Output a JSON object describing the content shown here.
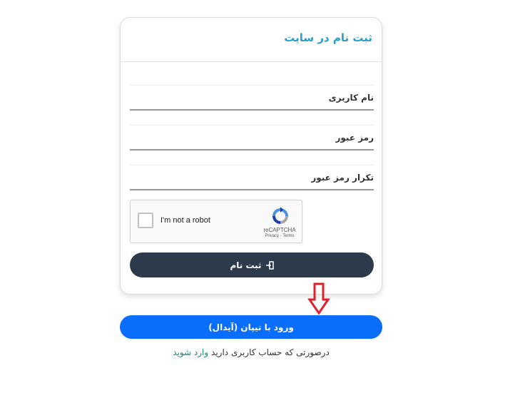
{
  "form": {
    "title": "ثبت نام در سایت",
    "fields": [
      {
        "placeholder": "نام کاربری",
        "value": ""
      },
      {
        "placeholder": "رمز عبور",
        "value": ""
      },
      {
        "placeholder": "تکرار رمز عبور",
        "value": ""
      }
    ],
    "captcha": {
      "label": "I'm not a robot",
      "brand": "reCAPTCHA",
      "links": "Privacy - Terms",
      "checked": false
    },
    "register_label": "ثبت نام",
    "register_icon": "sign-in-icon"
  },
  "login": {
    "label": "ورود با تیپان (آیدال)"
  },
  "footer": {
    "text": "درصورتی که حساب کاربری دارید",
    "link": "وارد شوید"
  },
  "annotation": {
    "arrow_color": "#e0202a"
  },
  "colors": {
    "title": "#2a9fc4",
    "register_button": "#2d3a4b",
    "login_button": "#0a6efd",
    "link": "#1a8a7a"
  }
}
